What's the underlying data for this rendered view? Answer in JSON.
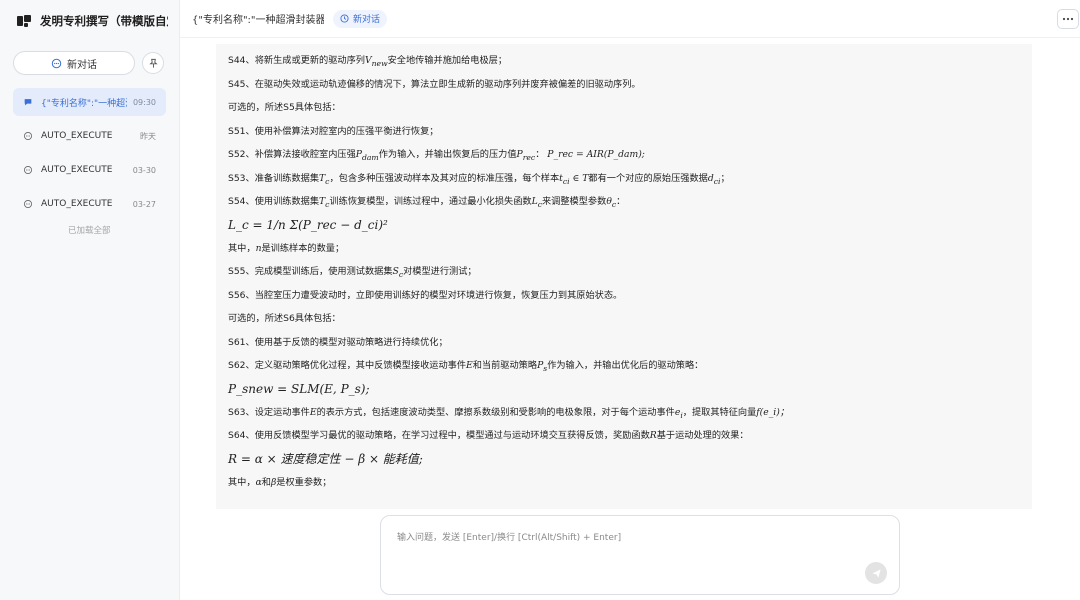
{
  "app": {
    "title": "发明专利撰写（带模版自定义）"
  },
  "sidebar": {
    "new_chat_label": "新对话",
    "conversations": [
      {
        "label": "{\"专利名称\":\"一种超滑封装器件",
        "time": "09:30",
        "active": true
      },
      {
        "label": "AUTO_EXECUTE",
        "time": "昨天"
      },
      {
        "label": "AUTO_EXECUTE",
        "time": "03-30"
      },
      {
        "label": "AUTO_EXECUTE",
        "time": "03-27"
      }
    ],
    "loaded_all": "已加载全部"
  },
  "topbar": {
    "chat_title": "{\"专利名称\":\"一种超滑封装器件",
    "new_chat_label": "新对话"
  },
  "message": {
    "lines": [
      {
        "pre": "S44、将新生成或更新的驱动序列",
        "math": "V",
        "sub": "new",
        "post": "安全地传输并施加给电极层；"
      },
      {
        "text": "S45、在驱动失效或运动轨迹偏移的情况下，算法立即生成新的驱动序列并废弃被偏差的旧驱动序列。"
      },
      {
        "text": "可选的，所述S5具体包括："
      },
      {
        "text": "S51、使用补偿算法对腔室内的压强平衡进行恢复；"
      },
      {
        "pre": "S52、补偿算法接收腔室内压强",
        "math": "P",
        "sub": "dam",
        "mid": "作为输入，并输出恢复后的压力值",
        "math2": "P",
        "sub2": "rec",
        "post": "：",
        "eq": "P_rec = AIR(P_dam);"
      },
      {
        "pre": "S53、准备训练数据集",
        "math": "T",
        "sub": "c",
        "mid": "，包含多种压强波动样本及其对应的标准压强，每个样本",
        "math2": "t",
        "sub2": "ci",
        "post": " ∈ T",
        "post2": "都有一个对应的原始压强数据",
        "math3": "d",
        "sub3": "ci",
        "tail": "；"
      },
      {
        "pre": "S54、使用训练数据集",
        "math": "T",
        "sub": "c",
        "mid": "训练恢复模型，训练过程中，通过最小化损失函数",
        "math2": "L",
        "sub2": "c",
        "post": "来调整模型参数",
        "math3": "θ",
        "sub3": "c",
        "tail": "："
      },
      {
        "formula": "L_c = 1/n Σ(P_rec − d_ci)²"
      },
      {
        "pre": "其中，",
        "math": "n",
        "post": "是训练样本的数量；"
      },
      {
        "pre": "S55、完成模型训练后，使用测试数据集",
        "math": "S",
        "sub": "c",
        "post": "对模型进行测试；"
      },
      {
        "text": "S56、当腔室压力遭受波动时，立即使用训练好的模型对环境进行恢复，恢复压力到其原始状态。"
      },
      {
        "text": "可选的，所述S6具体包括："
      },
      {
        "text": "S61、使用基于反馈的模型对驱动策略进行持续优化；"
      },
      {
        "pre": "S62、定义驱动策略优化过程，其中反馈模型接收运动事件",
        "math": "E",
        "mid": "和当前驱动策略",
        "math2": "P",
        "sub2": "s",
        "post": "作为输入，并输出优化后的驱动策略："
      },
      {
        "formula": "P_snew = SLM(E, P_s);"
      },
      {
        "pre": "S63、设定运动事件",
        "math": "E",
        "mid": "的表示方式，包括速度波动类型、摩擦系数级别和受影响的电极象限，对于每个运动事件",
        "math2": "e",
        "sub2": "i",
        "post": "，提取其特征向量",
        "tail": "f(e_i)；"
      },
      {
        "pre": "S64、使用反馈模型学习最优的驱动策略，在学习过程中，模型通过与运动环境交互获得反馈，奖励函数",
        "math": "R",
        "post": "基于运动处理的效果："
      },
      {
        "formula": "R = α × 速度稳定性 − β × 能耗值;"
      },
      {
        "pre": "其中，",
        "math": "α",
        "mid": "和",
        "math2": "β",
        "post": "是权重参数；"
      }
    ]
  },
  "input": {
    "placeholder": "输入问题，发送 [Enter]/换行 [Ctrl(Alt/Shift) + Enter]"
  }
}
